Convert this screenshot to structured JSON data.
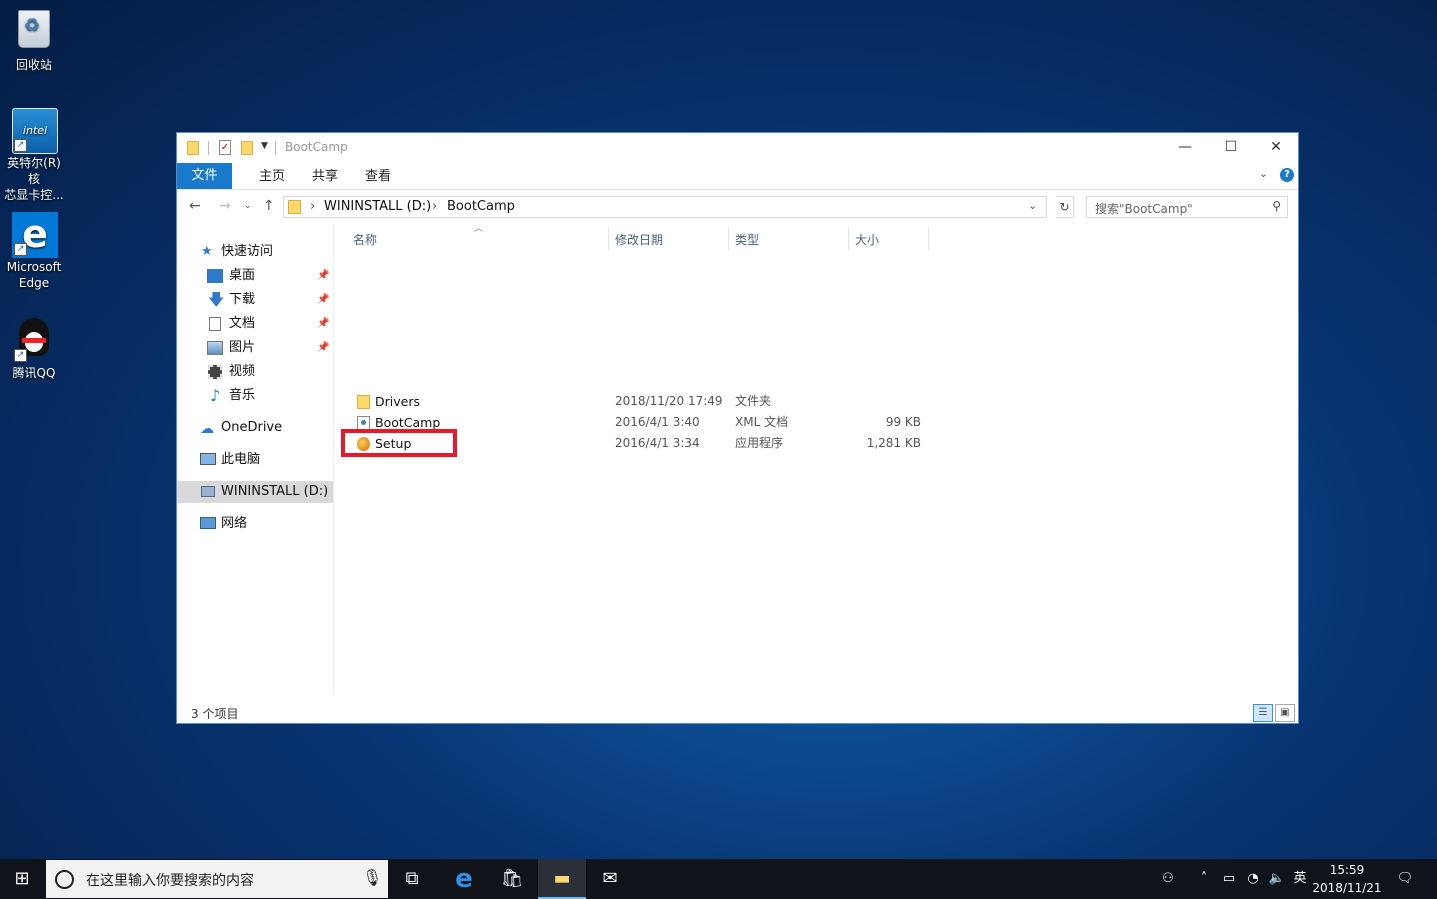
{
  "desktop": {
    "icons": [
      {
        "label": "回收站",
        "icon": "recycle-bin-icon"
      },
      {
        "label": "英特尔(R) 核\n芯显卡控...",
        "icon": "intel-graphics-icon"
      },
      {
        "label": "Microsoft\nEdge",
        "icon": "edge-icon"
      },
      {
        "label": "腾讯QQ",
        "icon": "qq-icon"
      }
    ]
  },
  "window": {
    "title": "BootCamp",
    "ribbon_tabs": [
      "文件",
      "主页",
      "共享",
      "查看"
    ],
    "address": {
      "drive": "WININSTALL (D:)",
      "folder": "BootCamp"
    },
    "search_placeholder": "搜索\"BootCamp\"",
    "nav": {
      "quick_access": "快速访问",
      "pinned": [
        "桌面",
        "下载",
        "文档",
        "图片"
      ],
      "unpinned": [
        "视频",
        "音乐"
      ],
      "onedrive": "OneDrive",
      "this_pc": "此电脑",
      "drive": "WININSTALL (D:)",
      "network": "网络"
    },
    "columns": [
      "名称",
      "修改日期",
      "类型",
      "大小"
    ],
    "files": [
      {
        "name": "Drivers",
        "date": "2018/11/20 17:49",
        "type": "文件夹",
        "size": "",
        "icon": "folder-icon"
      },
      {
        "name": "BootCamp",
        "date": "2016/4/1 3:40",
        "type": "XML 文档",
        "size": "99 KB",
        "icon": "xml-file-icon"
      },
      {
        "name": "Setup",
        "date": "2016/4/1 3:34",
        "type": "应用程序",
        "size": "1,281 KB",
        "icon": "setup-exe-icon"
      }
    ],
    "status": "3 个项目",
    "highlight_color": "#e8182b"
  },
  "taskbar": {
    "search_placeholder": "在这里输入你要搜索的内容",
    "time": "15:59",
    "date": "2018/11/21",
    "ime": "英"
  }
}
